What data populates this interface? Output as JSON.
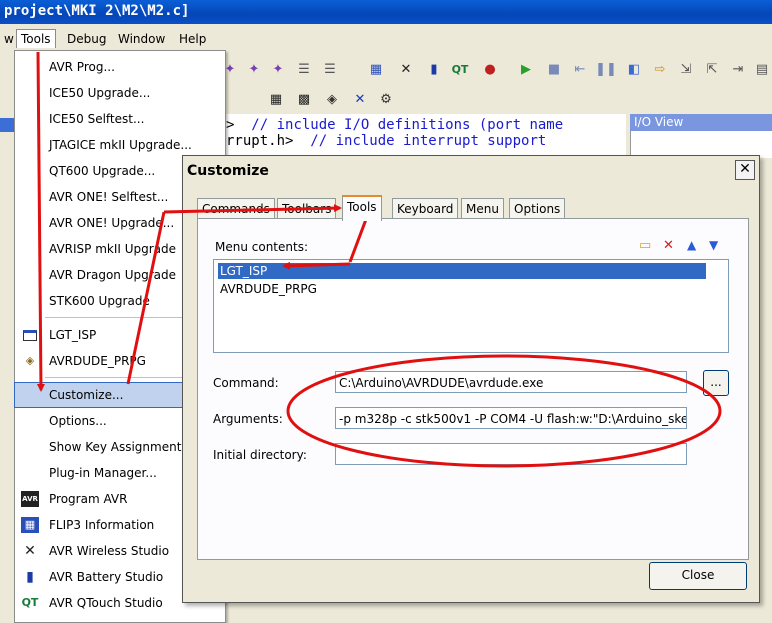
{
  "window": {
    "title": "project\\MKI 2\\M2\\M2.c]"
  },
  "menubar": {
    "items": [
      "w",
      "Tools",
      "Debug",
      "Window",
      "Help"
    ]
  },
  "editor": {
    "line1_code": ">",
    "line1_comment": "  // include I/O definitions (port name",
    "line2_code": "rrupt.h>",
    "line2_comment": "  // include interrupt support"
  },
  "ioview": {
    "title": "I/O View"
  },
  "tools_menu": {
    "items": [
      "AVR Prog...",
      "ICE50 Upgrade...",
      "ICE50 Selftest...",
      "JTAGICE mkII Upgrade...",
      "QT600 Upgrade...",
      "AVR ONE! Selftest...",
      "AVR ONE! Upgrade...",
      "AVRISP mkII Upgrade",
      "AVR Dragon Upgrade",
      "STK600 Upgrade",
      "LGT_ISP",
      "AVRDUDE_PRPG",
      "Customize...",
      "Options...",
      "Show Key Assignments",
      "Plug-in Manager...",
      "Program AVR",
      "FLIP3 Information",
      "AVR Wireless Studio",
      "AVR Battery Studio",
      "AVR QTouch Studio"
    ],
    "icon_labels": {
      "program_avr": "AVR",
      "qtouch": "QT"
    }
  },
  "dialog": {
    "title": "Customize",
    "close": "✕",
    "tabs": [
      "Commands",
      "Toolbars",
      "Tools",
      "Keyboard",
      "Menu",
      "Options"
    ],
    "menu_contents_label": "Menu contents:",
    "menu_contents": [
      "LGT_ISP",
      "AVRDUDE_PRPG"
    ],
    "command_label": "Command:",
    "command_value": "C:\\Arduino\\AVRDUDE\\avrdude.exe",
    "browse_label": "...",
    "arguments_label": "Arguments:",
    "arguments_value": "-p m328p -c stk500v1 -P COM4 -U flash:w:\"D:\\Arduino_sket",
    "initial_dir_label": "Initial directory:",
    "initial_dir_value": "",
    "close_button": "Close"
  },
  "colors": {
    "annotation_red": "#e01010",
    "selection_blue": "#316AC5",
    "title_blue": "#0A5FD6"
  }
}
